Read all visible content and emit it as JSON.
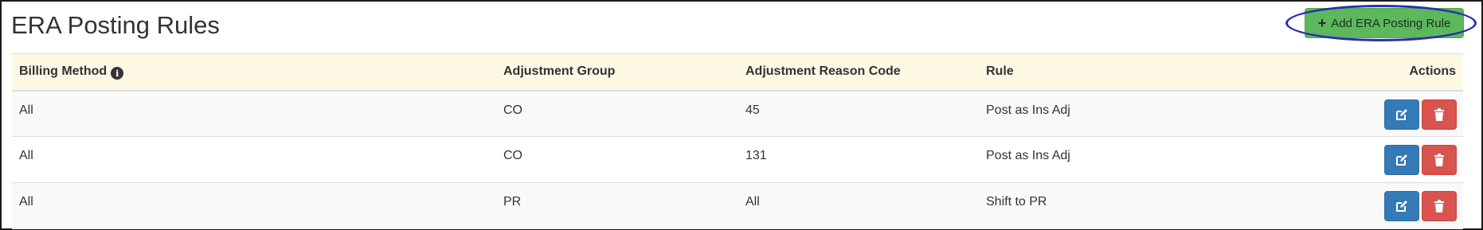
{
  "page": {
    "title": "ERA Posting Rules",
    "add_button_label": "Add ERA Posting Rule"
  },
  "table": {
    "headers": {
      "billing_method": "Billing Method",
      "adjustment_group": "Adjustment Group",
      "adjustment_reason_code": "Adjustment Reason Code",
      "rule": "Rule",
      "actions": "Actions"
    },
    "rows": [
      {
        "billing_method": "All",
        "adjustment_group": "CO",
        "adjustment_reason_code": "45",
        "rule": "Post as Ins Adj"
      },
      {
        "billing_method": "All",
        "adjustment_group": "CO",
        "adjustment_reason_code": "131",
        "rule": "Post as Ins Adj"
      },
      {
        "billing_method": "All",
        "adjustment_group": "PR",
        "adjustment_reason_code": "All",
        "rule": "Shift to PR"
      }
    ]
  },
  "icons": {
    "add": "plus-icon",
    "info": "info-icon",
    "edit": "edit-icon",
    "delete": "trash-icon"
  },
  "colors": {
    "add_button": "#5cb85c",
    "edit_button": "#337ab7",
    "delete_button": "#d9534f",
    "header_row": "#fcf8e3",
    "highlight_ellipse": "#2a2fb0"
  }
}
